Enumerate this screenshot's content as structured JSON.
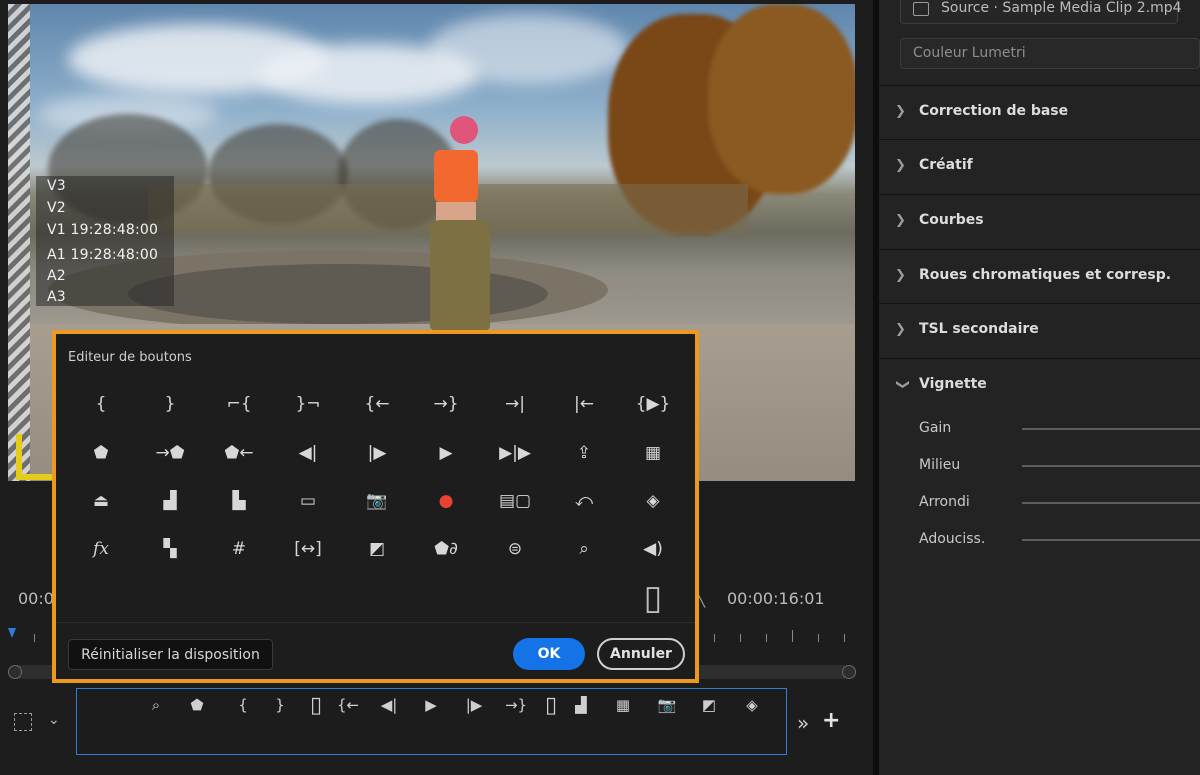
{
  "tracks": [
    "V3",
    "V2",
    "V1 19:28:48:00",
    "A1 19:28:48:00",
    "A2",
    "A3"
  ],
  "timecode": {
    "left": "00:0",
    "right": "00:00:16:01"
  },
  "dialog": {
    "title": "Editeur de boutons",
    "rows": [
      [
        "mark-in-icon",
        "mark-out-icon",
        "mark-clip-in-icon",
        "mark-clip-out-icon",
        "go-to-in-icon",
        "go-to-out-icon",
        "go-to-next-edit-icon",
        "go-to-previous-edit-icon",
        "play-in-to-out-icon"
      ],
      [
        "add-marker-icon",
        "go-to-next-marker-icon",
        "go-to-previous-marker-icon",
        "step-back-icon",
        "step-forward-icon",
        "play-icon",
        "trim-icon",
        "export-icon",
        "overwrite-icon"
      ],
      [
        "lift-icon",
        "extract-icon",
        "insert-icon",
        "safe-margins-icon",
        "camera-icon",
        "record-icon",
        "multi-camera-icon",
        "loop-icon",
        "comparison-view-icon"
      ],
      [
        "fx-icon",
        "button-editor-icon",
        "grid-icon",
        "proxy-icon",
        "stack-icon",
        "marker-link-icon",
        "vr-video-icon",
        "find-icon",
        "volume-icon"
      ],
      [
        "spacer-icon"
      ]
    ],
    "glyphs": {
      "mark-in-icon": "{",
      "mark-out-icon": "}",
      "mark-clip-in-icon": "⌐{",
      "mark-clip-out-icon": "}¬",
      "go-to-in-icon": "{←",
      "go-to-out-icon": "→}",
      "go-to-next-edit-icon": "→|",
      "go-to-previous-edit-icon": "|←",
      "play-in-to-out-icon": "{▶}",
      "add-marker-icon": "⬟",
      "go-to-next-marker-icon": "→⬟",
      "go-to-previous-marker-icon": "⬟←",
      "step-back-icon": "◀|",
      "step-forward-icon": "|▶",
      "play-icon": "▶",
      "trim-icon": "▶|▶",
      "export-icon": "⇪",
      "overwrite-icon": "▦",
      "lift-icon": "⏏",
      "extract-icon": "▟",
      "insert-icon": "▙",
      "safe-margins-icon": "▭",
      "camera-icon": "📷",
      "record-icon": "●",
      "multi-camera-icon": "▤▢",
      "loop-icon": "⤺",
      "comparison-view-icon": "◈",
      "fx-icon": "fx",
      "button-editor-icon": "▚",
      "grid-icon": "#",
      "proxy-icon": "[↔]",
      "stack-icon": "◩",
      "marker-link-icon": "⬟∂",
      "vr-video-icon": "⊜",
      "find-icon": "⌕",
      "volume-icon": "◀)",
      "spacer-icon": "▯"
    },
    "reset_label": "Réinitialiser la disposition",
    "ok_label": "OK",
    "cancel_label": "Annuler"
  },
  "button_bar": {
    "icons": [
      "find-icon",
      "add-marker-icon",
      "mark-in-icon",
      "mark-out-icon",
      "spacer-icon",
      "go-to-in-icon",
      "step-back-icon",
      "play-icon",
      "step-forward-icon",
      "go-to-out-icon",
      "spacer-icon",
      "extract-icon",
      "overwrite-icon",
      "camera-icon",
      "stack-icon",
      "comparison-view-icon"
    ],
    "more_label": "»",
    "add_label": "+"
  },
  "right_panel": {
    "source_tab": "Source · Sample Media Clip 2.mp4",
    "lumetri_label": "Couleur Lumetri",
    "sections": [
      "Correction de base",
      "Créatif",
      "Courbes",
      "Roues chromatiques et corresp.",
      "TSL secondaire",
      "Vignette"
    ],
    "vignette_sliders": [
      "Gain",
      "Milieu",
      "Arrondi",
      "Adouciss."
    ]
  },
  "colors": {
    "accent_orange": "#eb9a1e",
    "ok_blue": "#1473e6",
    "bar_border_blue": "#2f7dd6"
  }
}
